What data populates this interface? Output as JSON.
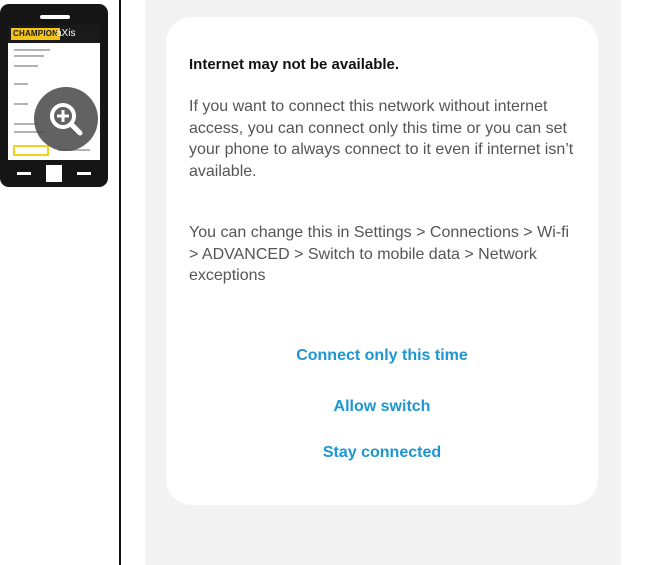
{
  "phone": {
    "brand_primary": "CHAMPION",
    "brand_secondary": "aXis",
    "brand_color": "#f2c41a",
    "zoom_icon": "zoom-in-icon"
  },
  "dialog": {
    "title": "Internet may not be available.",
    "paragraph_1": "If you want to connect this network without internet access, you can connect only this time or you can set your phone to always connect to it even if internet isn’t available.",
    "paragraph_2": "You can change this in Settings > Connections > Wi-fi > ADVANCED > Switch to mobile data > Network exceptions",
    "actions": [
      {
        "label": "Connect only this time"
      },
      {
        "label": "Allow switch"
      },
      {
        "label": "Stay connected"
      }
    ],
    "accent_color": "#1d96d3"
  }
}
